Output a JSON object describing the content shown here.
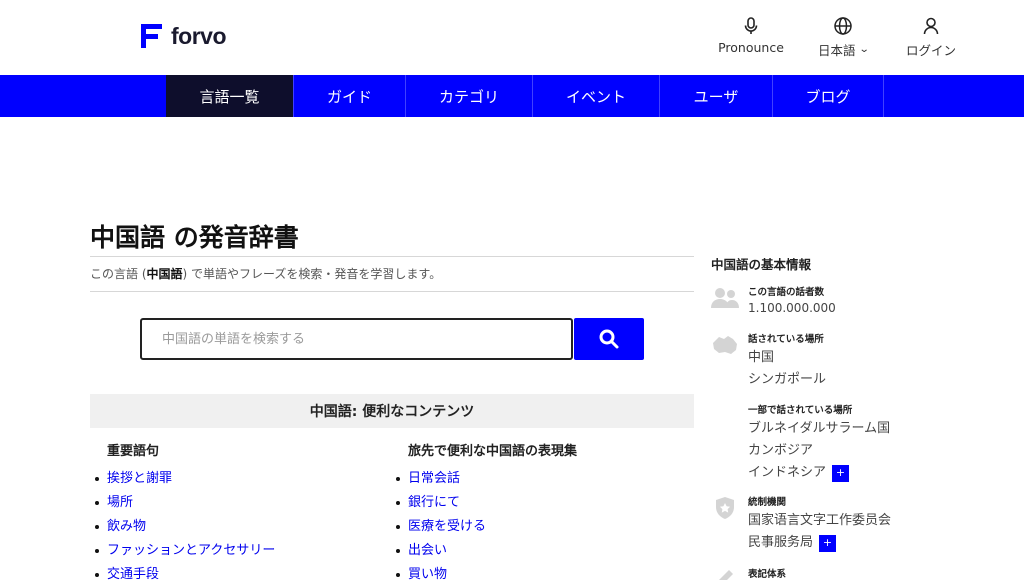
{
  "header": {
    "logo_text": "forvo",
    "pronounce_label": "Pronounce",
    "language_label": "日本語",
    "login_label": "ログイン"
  },
  "nav": {
    "items": [
      {
        "label": "言語一覧"
      },
      {
        "label": "ガイド"
      },
      {
        "label": "カテゴリ"
      },
      {
        "label": "イベント"
      },
      {
        "label": "ユーザ"
      },
      {
        "label": "ブログ"
      }
    ]
  },
  "main": {
    "title": "中国語 の発音辞書",
    "subtitle_pre": "この言語 (",
    "subtitle_lang": "中国語",
    "subtitle_post": ") で単語やフレーズを検索・発音を学習します。",
    "search_placeholder": "中国語の単語を検索する",
    "content_header": "中国語: 便利なコンテンツ",
    "left_title": "重要語句",
    "left_items": [
      "挨拶と謝罪",
      "場所",
      "飲み物",
      "ファッションとアクセサリー",
      "交通手段"
    ],
    "right_title": "旅先で便利な中国語の表現集",
    "right_items": [
      "日常会話",
      "銀行にて",
      "医療を受ける",
      "出会い",
      "買い物"
    ]
  },
  "sidebar": {
    "title": "中国語の基本情報",
    "speakers_label": "この言語の話者数",
    "speakers_value": "1.100.000.000",
    "spoken_label": "話されている場所",
    "spoken_values": [
      "中国",
      "シンガポール"
    ],
    "partly_label": "一部で話されている場所",
    "partly_values": [
      "ブルネイダルサラーム国",
      "カンボジア",
      "インドネシア"
    ],
    "regulator_label": "統制機関",
    "regulator_values": [
      "国家语言文字工作委员会",
      "民事服务局"
    ],
    "writing_label": "表記体系",
    "plus_symbol": "+"
  },
  "colors": {
    "brand_blue": "#0000ff",
    "nav_active": "#0e0e2c",
    "link": "#0000ee"
  }
}
